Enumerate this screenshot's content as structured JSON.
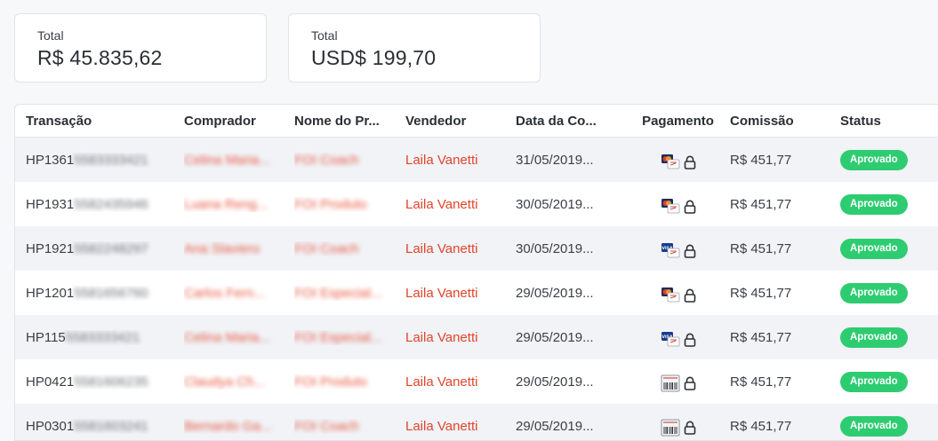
{
  "totals": [
    {
      "label": "Total",
      "value": "R$ 45.835,62"
    },
    {
      "label": "Total",
      "value": "USD$ 199,70"
    }
  ],
  "table": {
    "headers": [
      "Transação",
      "Comprador",
      "Nome do Pr...",
      "Vendedor",
      "Data da Co...",
      "Pagamento",
      "Comissão",
      "Status"
    ],
    "rows": [
      {
        "txn_prefix": "HP1361",
        "txn_hidden": "5583333421",
        "buyer": "Celina Maria...",
        "product": "FOI Coach",
        "seller": "Laila Vanetti",
        "date": "31/05/2019...",
        "payment_icon": "mastercard-icon",
        "commission": "R$ 451,77",
        "status": "Aprovado"
      },
      {
        "txn_prefix": "HP1931",
        "txn_hidden": "5582435946",
        "buyer": "Luana Reng...",
        "product": "FOI Produto",
        "seller": "Laila Vanetti",
        "date": "30/05/2019...",
        "payment_icon": "mastercard-icon",
        "commission": "R$ 451,77",
        "status": "Aprovado"
      },
      {
        "txn_prefix": "HP1921",
        "txn_hidden": "5582248297",
        "buyer": "Ana Slaviero",
        "product": "FOI Coach",
        "seller": "Laila Vanetti",
        "date": "30/05/2019...",
        "payment_icon": "visa-icon",
        "commission": "R$ 451,77",
        "status": "Aprovado"
      },
      {
        "txn_prefix": "HP1201",
        "txn_hidden": "5581656760",
        "buyer": "Carlos Fern...",
        "product": "FOI Especial...",
        "seller": "Laila Vanetti",
        "date": "29/05/2019...",
        "payment_icon": "mastercard-icon",
        "commission": "R$ 451,77",
        "status": "Aprovado"
      },
      {
        "txn_prefix": "HP115",
        "txn_hidden": "5583333421",
        "buyer": "Celina Maria...",
        "product": "FOI Especial...",
        "seller": "Laila Vanetti",
        "date": "29/05/2019...",
        "payment_icon": "visa-icon",
        "commission": "R$ 451,77",
        "status": "Aprovado"
      },
      {
        "txn_prefix": "HP0421",
        "txn_hidden": "5581606235",
        "buyer": "Claudya Ch...",
        "product": "FOI Produto",
        "seller": "Laila Vanetti",
        "date": "29/05/2019...",
        "payment_icon": "boleto-icon",
        "commission": "R$ 451,77",
        "status": "Aprovado"
      },
      {
        "txn_prefix": "HP0301",
        "txn_hidden": "5581603241",
        "buyer": "Bernardo Ga...",
        "product": "FOI Coach",
        "seller": "Laila Vanetti",
        "date": "29/05/2019...",
        "payment_icon": "boleto-icon",
        "commission": "R$ 451,77",
        "status": "Aprovado"
      }
    ]
  },
  "colors": {
    "accent_red": "#e0452b",
    "status_green": "#2ecc71"
  }
}
